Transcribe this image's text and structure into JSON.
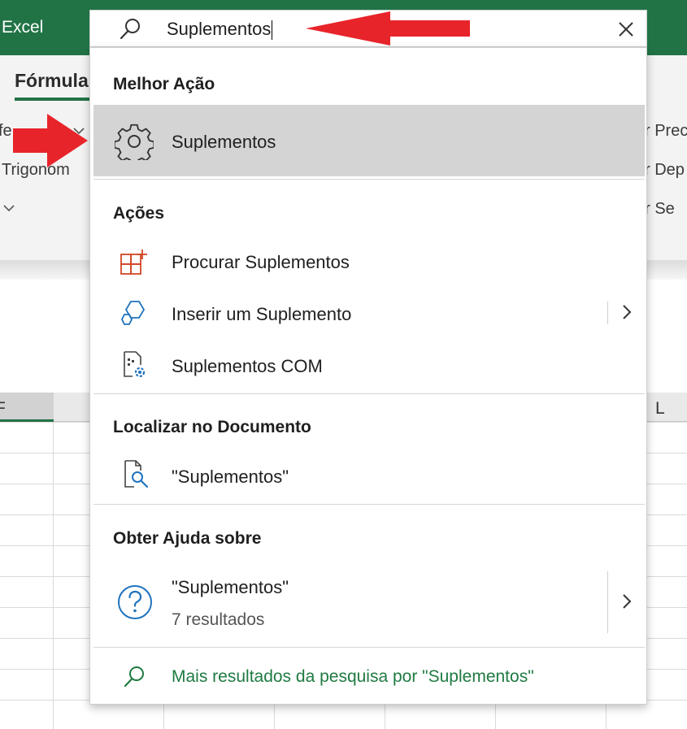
{
  "app": {
    "name": "Excel"
  },
  "ribbon": {
    "active_tab": "Fórmula",
    "fragments": {
      "row1_left": "fe",
      "row2_left": "Trigonom",
      "row1_right": "r Prec",
      "row2_right": "r Dep",
      "row3_right": "er Se"
    }
  },
  "grid": {
    "col_left": "F",
    "col_right": "L"
  },
  "search": {
    "value": "Suplementos"
  },
  "dropdown": {
    "best_action": {
      "title": "Melhor Ação",
      "item": {
        "label": "Suplementos",
        "icon": "gear-icon"
      }
    },
    "actions": {
      "title": "Ações",
      "items": [
        {
          "label": "Procurar Suplementos",
          "icon": "add-grid-icon"
        },
        {
          "label": "Inserir um Suplemento",
          "icon": "cube-icon"
        },
        {
          "label": "Suplementos COM",
          "icon": "com-addin-icon"
        }
      ]
    },
    "find_in_document": {
      "title": "Localizar no Documento",
      "item": {
        "label": "\"Suplementos\"",
        "icon": "document-search-icon"
      }
    },
    "help": {
      "title": "Obter Ajuda sobre",
      "item": {
        "label": "\"Suplementos\"",
        "sub": "7 resultados",
        "icon": "help-icon"
      }
    },
    "more_results": {
      "label": "Mais resultados da pesquisa por \"Suplementos\"",
      "icon": "search-icon"
    }
  },
  "colors": {
    "brand": "#217346",
    "highlight": "#d4d4d4",
    "arrow": "#e8242b",
    "link": "#1f7a42"
  }
}
